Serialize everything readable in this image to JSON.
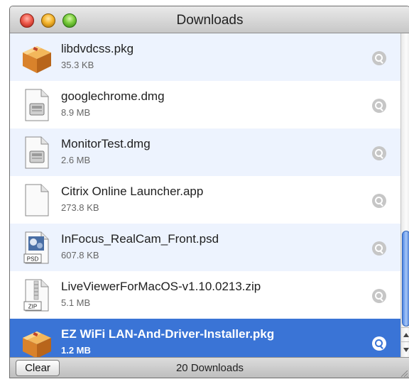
{
  "window": {
    "title": "Downloads"
  },
  "downloads": [
    {
      "name": "libdvdcss.pkg",
      "size": "35.3 KB",
      "icon": "package-icon"
    },
    {
      "name": "googlechrome.dmg",
      "size": "8.9 MB",
      "icon": "disk-image-icon"
    },
    {
      "name": "MonitorTest.dmg",
      "size": "2.6 MB",
      "icon": "disk-image-icon"
    },
    {
      "name": "Citrix Online Launcher.app",
      "size": "273.8 KB",
      "icon": "document-icon"
    },
    {
      "name": "InFocus_RealCam_Front.psd",
      "size": "607.8 KB",
      "icon": "psd-file-icon",
      "badge": "PSD"
    },
    {
      "name": "LiveViewerForMacOS-v1.10.0213.zip",
      "size": "5.1 MB",
      "icon": "zip-file-icon",
      "badge": "ZIP"
    },
    {
      "name": "EZ WiFi LAN-And-Driver-Installer.pkg",
      "size": "1.2 MB",
      "icon": "package-icon",
      "selected": true
    }
  ],
  "footer": {
    "clear_label": "Clear",
    "count_label": "20 Downloads"
  },
  "colors": {
    "selection": "#3a74d6",
    "alt_row": "#edf3fe"
  }
}
